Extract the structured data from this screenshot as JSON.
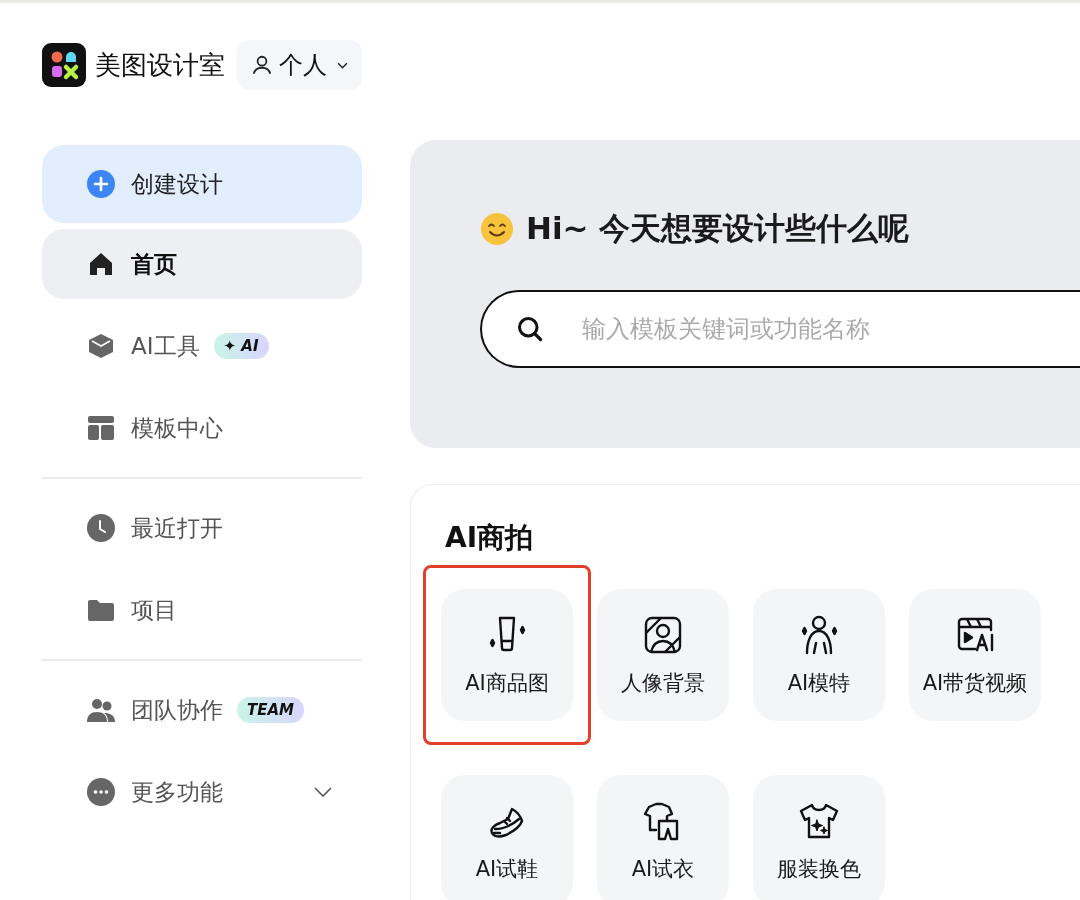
{
  "header": {
    "app_name": "美图设计室",
    "account_switch": {
      "label": "个人",
      "expanded": false
    }
  },
  "sidebar": {
    "create_button": "创建设计",
    "groups": [
      [
        {
          "label": "首页",
          "selected": true
        },
        {
          "label": "AI工具",
          "selected": false,
          "badge": "✦ AI"
        },
        {
          "label": "模板中心",
          "selected": false
        }
      ],
      [
        {
          "label": "最近打开",
          "selected": false
        },
        {
          "label": "项目",
          "selected": false
        }
      ],
      [
        {
          "label": "团队协作",
          "selected": false,
          "badge": "TEAM"
        },
        {
          "label": "更多功能",
          "selected": false,
          "expanded": false
        }
      ]
    ]
  },
  "hero": {
    "greeting": "Hi~ 今天想要设计些什么呢",
    "search": {
      "placeholder": "输入模板关键词或功能名称"
    }
  },
  "section": {
    "title": "AI商拍",
    "tools": [
      {
        "label": "AI商品图",
        "highlighted": true
      },
      {
        "label": "人像背景",
        "highlighted": false
      },
      {
        "label": "AI模特",
        "highlighted": false
      },
      {
        "label": "AI带货视频",
        "highlighted": false
      },
      {
        "label": "AI试鞋",
        "highlighted": false
      },
      {
        "label": "AI试衣",
        "highlighted": false
      },
      {
        "label": "服装换色",
        "highlighted": false
      }
    ]
  }
}
